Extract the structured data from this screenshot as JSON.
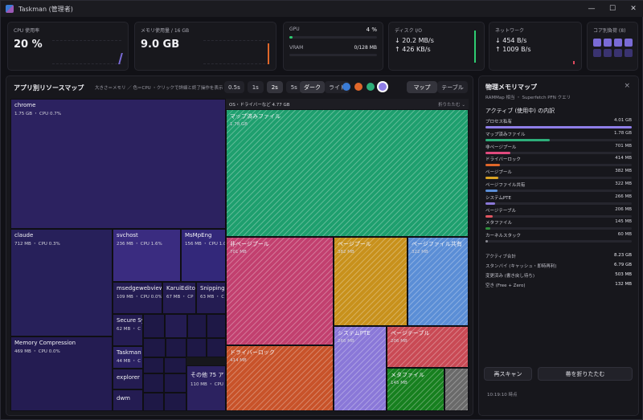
{
  "window": {
    "title": "Taskman (管理者)",
    "minimize": "—",
    "maximize": "☐",
    "close": "✕"
  },
  "cards": {
    "cpu": {
      "label": "CPU 使用率",
      "value": "20 %"
    },
    "mem": {
      "label": "メモリ使用量 / 16 GB",
      "value": "9.0 GB"
    },
    "gpu": {
      "label": "GPU",
      "value": "4 %",
      "vram_label": "VRAM",
      "vram_value": "0/128 MB",
      "gpu_level": 0.04
    },
    "disk": {
      "label": "ディスク I/O",
      "read": "↓ 20.2 MB/s",
      "write": "↑ 426 KB/s"
    },
    "net": {
      "label": "ネットワーク",
      "down": "↓ 454 B/s",
      "up": "↑ 1009 B/s"
    },
    "cores": {
      "label": "コア別負荷 (8)",
      "colors": [
        "#7a6bd6",
        "#7a6bd6",
        "#7a6bd6",
        "#7a6bd6",
        "#3a3370",
        "#3a3370",
        "#3a3370",
        "#3a3370"
      ]
    }
  },
  "map": {
    "title": "アプリ別リソースマップ",
    "hint": "大きさ＝メモリ ／ 色＝CPU ・クリックで詳細と終了操作を表示",
    "speeds": [
      "0.5s",
      "1s",
      "2s",
      "5s"
    ],
    "speed_selected": "2s",
    "themes": [
      "ダーク",
      "ライト"
    ],
    "theme_selected": "ダーク",
    "palette": [
      "#3a7bd5",
      "#e0672a",
      "#2eae7a",
      "#8f7ee8"
    ],
    "views": [
      "マップ",
      "テーブル"
    ],
    "view_selected": "マップ",
    "apps": [
      {
        "name": "chrome",
        "sub": "1.75 GB ・ CPU 0.7%"
      },
      {
        "name": "claude",
        "sub": "712 MB ・ CPU 0.3%"
      },
      {
        "name": "svchost",
        "sub": "236 MB ・ CPU 1.6%"
      },
      {
        "name": "MsMpEng",
        "sub": "156 MB ・ CPU 1.0"
      },
      {
        "name": "msedgewebview",
        "sub": "109 MB ・ CPU 0.0%"
      },
      {
        "name": "KaruiEdito",
        "sub": "67 MB ・ CP"
      },
      {
        "name": "Snipping",
        "sub": "63 MB ・ C"
      },
      {
        "name": "Secure Sy",
        "sub": "62 MB ・ C"
      },
      {
        "name": "Memory Compression",
        "sub": "469 MB ・ CPU 0.0%"
      },
      {
        "name": "Taskman",
        "sub": "44 MB ・ C"
      },
      {
        "name": "explorer",
        "sub": ""
      },
      {
        "name": "dwm",
        "sub": ""
      },
      {
        "name": "その他 75 ア",
        "sub": "110 MB ・ CPU"
      }
    ],
    "os": {
      "label": "OS・ドライバーなど 4.77 GB",
      "fold": "折りたたむ ⌄",
      "blocks": [
        {
          "name": "マップ済みファイル",
          "sub": "1.78 GB",
          "color": "#1e9f6e"
        },
        {
          "name": "非ページプール",
          "sub": "701 MB",
          "color": "#c2406f"
        },
        {
          "name": "ページプール",
          "sub": "382 MB",
          "color": "#c8911c"
        },
        {
          "name": "ページファイル共有",
          "sub": "322 MB",
          "color": "#5b8ed6"
        },
        {
          "name": "ドライバーロック",
          "sub": "414 MB",
          "color": "#c8532a"
        },
        {
          "name": "システムPTE",
          "sub": "266 MB",
          "color": "#8a78d8"
        },
        {
          "name": "ページテーブル",
          "sub": "206 MB",
          "color": "#c94a55"
        },
        {
          "name": "メタファイル",
          "sub": "145 MB",
          "color": "#17801f"
        },
        {
          "name": "",
          "sub": "",
          "color": "#6a6a6a"
        }
      ]
    }
  },
  "phys": {
    "title": "物理メモリマップ",
    "sub": "RAMMap 相当 ・ Superfetch PFN クエリ",
    "close": "×",
    "active_label": "アクティブ (使用中) の内訳",
    "rows": [
      {
        "name": "プロセス私有",
        "value": "4.01 GB",
        "frac": 1.0,
        "color": "#8f7ee8"
      },
      {
        "name": "マップ済みファイル",
        "value": "1.78 GB",
        "frac": 0.44,
        "color": "#2eae7a"
      },
      {
        "name": "非ページプール",
        "value": "701 MB",
        "frac": 0.17,
        "color": "#e04a7e"
      },
      {
        "name": "ドライバーロック",
        "value": "414 MB",
        "frac": 0.1,
        "color": "#e0672a"
      },
      {
        "name": "ページプール",
        "value": "382 MB",
        "frac": 0.09,
        "color": "#d9a324"
      },
      {
        "name": "ページファイル共有",
        "value": "322 MB",
        "frac": 0.08,
        "color": "#5b8ed6"
      },
      {
        "name": "システムPTE",
        "value": "266 MB",
        "frac": 0.065,
        "color": "#8a78d8"
      },
      {
        "name": "ページテーブル",
        "value": "206 MB",
        "frac": 0.05,
        "color": "#e05560"
      },
      {
        "name": "メタファイル",
        "value": "145 MB",
        "frac": 0.035,
        "color": "#2e8f3a"
      },
      {
        "name": "カーネルスタック",
        "value": "60 MB",
        "frac": 0.015,
        "color": "#8a8a92"
      }
    ],
    "stats": [
      {
        "name": "アクティブ合計",
        "value": "8.23 GB"
      },
      {
        "name": "スタンバイ (キャッシュ・即時再利)",
        "value": "6.79 GB"
      },
      {
        "name": "変更済み (書き戻し待ち)",
        "value": "503 MB"
      },
      {
        "name": "空き (Free + Zero)",
        "value": "132 MB"
      }
    ],
    "rescan": "再スキャン",
    "collapse": "帯を折りたたむ",
    "timestamp": "10:19:10 時点"
  }
}
